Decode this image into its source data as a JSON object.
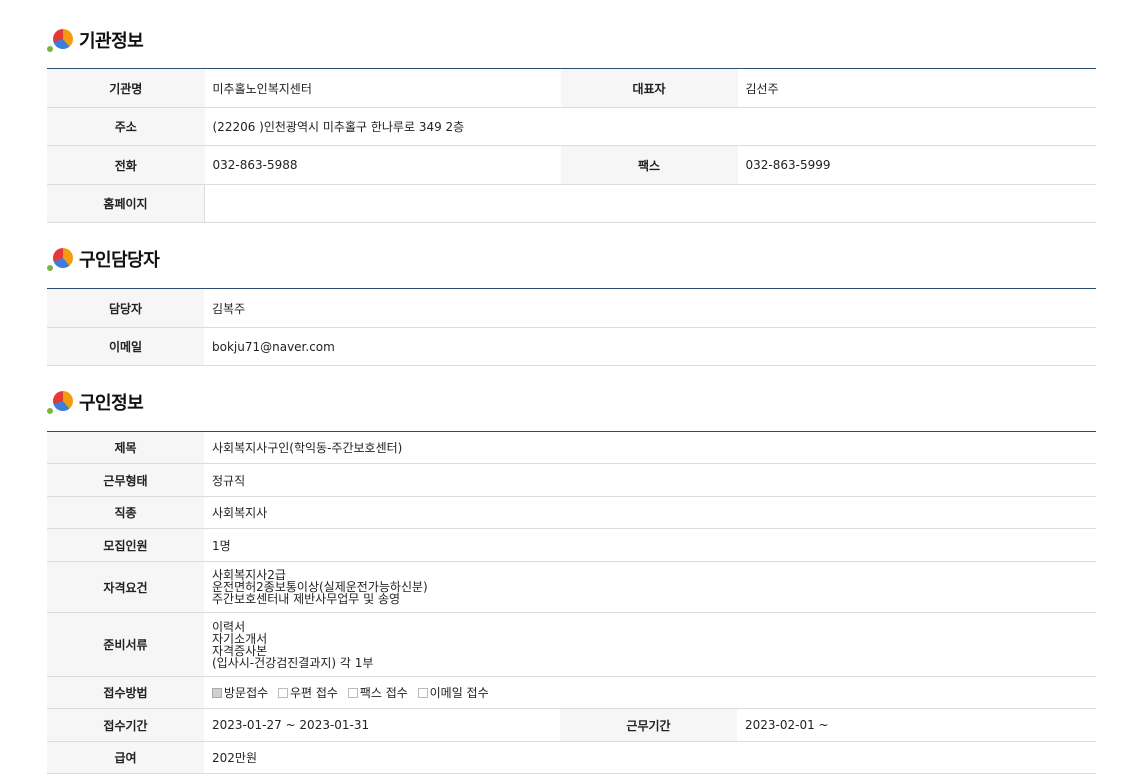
{
  "sections": {
    "org": {
      "title": "기관정보",
      "rows": {
        "name": {
          "label": "기관명",
          "value": "미추홀노인복지센터"
        },
        "rep": {
          "label": "대표자",
          "value": "김선주"
        },
        "addr": {
          "label": "주소",
          "value": "(22206 )인천광역시 미추홀구 한나루로 349 2층"
        },
        "phone": {
          "label": "전화",
          "value": "032-863-5988"
        },
        "fax": {
          "label": "팩스",
          "value": "032-863-5999"
        },
        "homepage": {
          "label": "홈페이지",
          "value": ""
        }
      }
    },
    "contact": {
      "title": "구인담당자",
      "rows": {
        "person": {
          "label": "담당자",
          "value": "김복주"
        },
        "email": {
          "label": "이메일",
          "value": "bokju71@naver.com"
        }
      }
    },
    "job": {
      "title": "구인정보",
      "rows": {
        "subject": {
          "label": "제목",
          "value": "사회복지사구인(학익동-주간보호센터)"
        },
        "worktype": {
          "label": "근무형태",
          "value": "정규직"
        },
        "jobtype": {
          "label": "직종",
          "value": "사회복지사"
        },
        "count": {
          "label": "모집인원",
          "value": "1명"
        },
        "qual": {
          "label": "자격요건",
          "lines": [
            "사회복지사2급",
            "운전면허2종보통이상(실제운전가능하신분)",
            "주간보호센터내 제반사무업무 및 송영"
          ]
        },
        "docs": {
          "label": "준비서류",
          "lines": [
            "이력서",
            "자기소개서",
            "자격증사본",
            "(입사시-건강검진결과지) 각 1부"
          ]
        },
        "method": {
          "label": "접수방법",
          "options": [
            {
              "label": "방문접수",
              "checked": true
            },
            {
              "label": "우편 접수",
              "checked": false
            },
            {
              "label": "팩스 접수",
              "checked": false
            },
            {
              "label": "이메일 접수",
              "checked": false
            }
          ]
        },
        "period": {
          "label": "접수기간",
          "value": "2023-01-27 ~ 2023-01-31"
        },
        "workperiod": {
          "label": "근무기간",
          "value": "2023-02-01 ~"
        },
        "pay": {
          "label": "급여",
          "value": "202만원"
        }
      }
    }
  }
}
